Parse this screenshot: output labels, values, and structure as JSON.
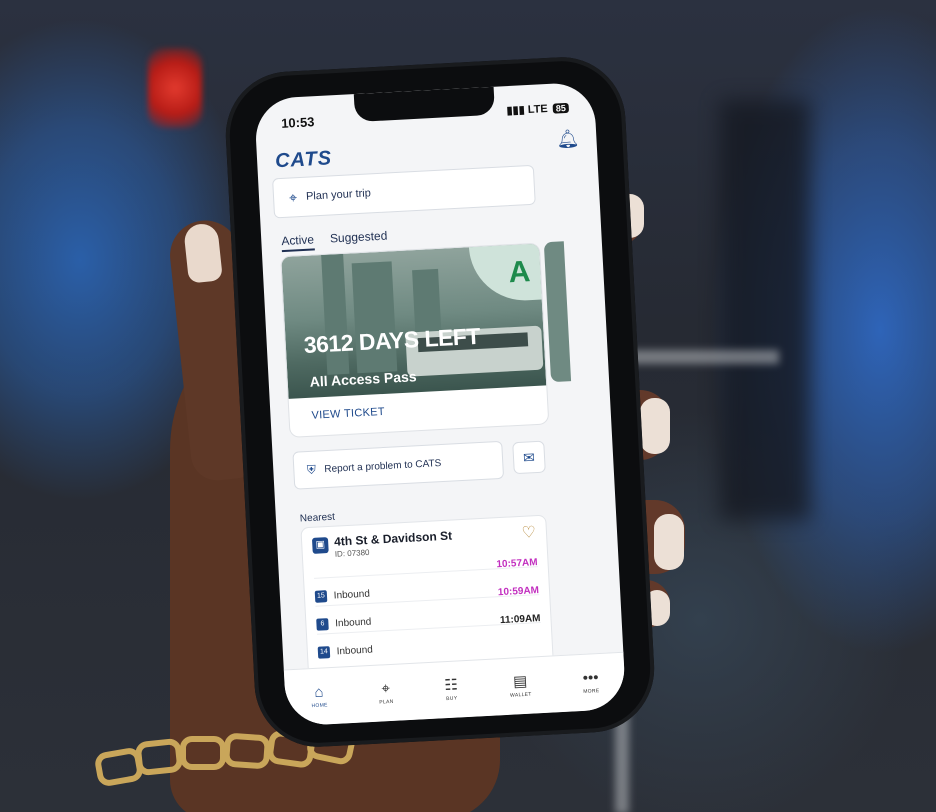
{
  "status": {
    "time": "10:53",
    "network": "LTE",
    "battery": "85"
  },
  "app": {
    "logo_text": "CATS"
  },
  "plan": {
    "label": "Plan your trip"
  },
  "tabs": [
    {
      "label": "Active"
    },
    {
      "label": "Suggested"
    }
  ],
  "pass": {
    "badge": "A",
    "days_left": "3612 DAYS LEFT",
    "name": "All Access Pass",
    "view_label": "VIEW TICKET"
  },
  "report": {
    "label": "Report a problem to CATS"
  },
  "nearest": {
    "label": "Nearest",
    "stop_name": "4th St & Davidson St",
    "stop_id": "ID: 07380",
    "arrivals": [
      {
        "route": "15",
        "direction": "Inbound",
        "time": "10:57AM",
        "color": "#c22fbf"
      },
      {
        "route": "6",
        "direction": "Inbound",
        "time": "10:59AM",
        "color": "#c22fbf"
      },
      {
        "route": "14",
        "direction": "Inbound",
        "time": "11:09AM",
        "color": "#222222"
      }
    ]
  },
  "nav": [
    {
      "label": "HOME",
      "icon": "home-icon"
    },
    {
      "label": "PLAN",
      "icon": "pin-icon"
    },
    {
      "label": "BUY",
      "icon": "cart-icon"
    },
    {
      "label": "WALLET",
      "icon": "wallet-icon"
    },
    {
      "label": "MORE",
      "icon": "dots-icon"
    }
  ],
  "colors": {
    "brand": "#1f4a8c",
    "pass_green": "#1e8a4c",
    "favorite": "#b78a3c"
  }
}
